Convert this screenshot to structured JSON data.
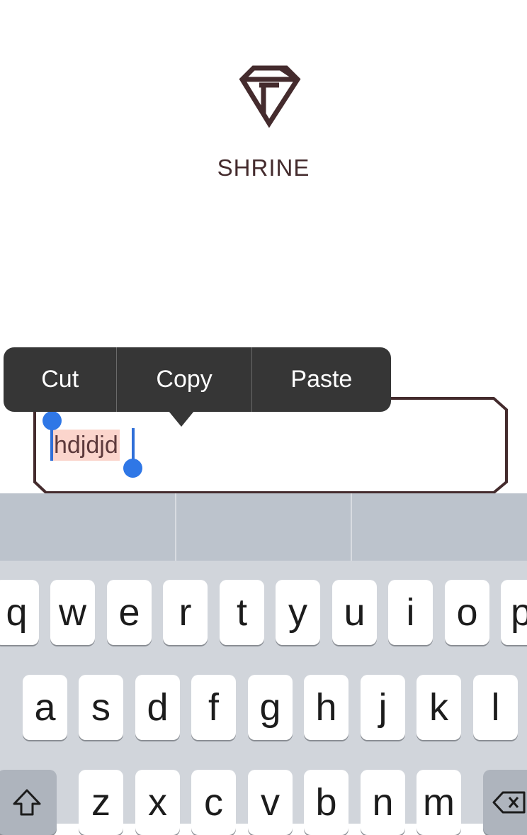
{
  "app": {
    "name": "SHRINE"
  },
  "field": {
    "selected_text": "hdjdjd"
  },
  "edit_menu": {
    "items": [
      "Cut",
      "Copy",
      "Paste"
    ]
  },
  "keyboard": {
    "row1": [
      "q",
      "w",
      "e",
      "r",
      "t",
      "y",
      "u",
      "i",
      "o",
      "p"
    ],
    "row2": [
      "a",
      "s",
      "d",
      "f",
      "g",
      "h",
      "j",
      "k",
      "l"
    ],
    "row3": [
      "z",
      "x",
      "c",
      "v",
      "b",
      "n",
      "m"
    ]
  },
  "colors": {
    "brand": "#442b2d",
    "selection": "#fbd5cc",
    "handle": "#2f77e6",
    "menu": "#363636"
  }
}
